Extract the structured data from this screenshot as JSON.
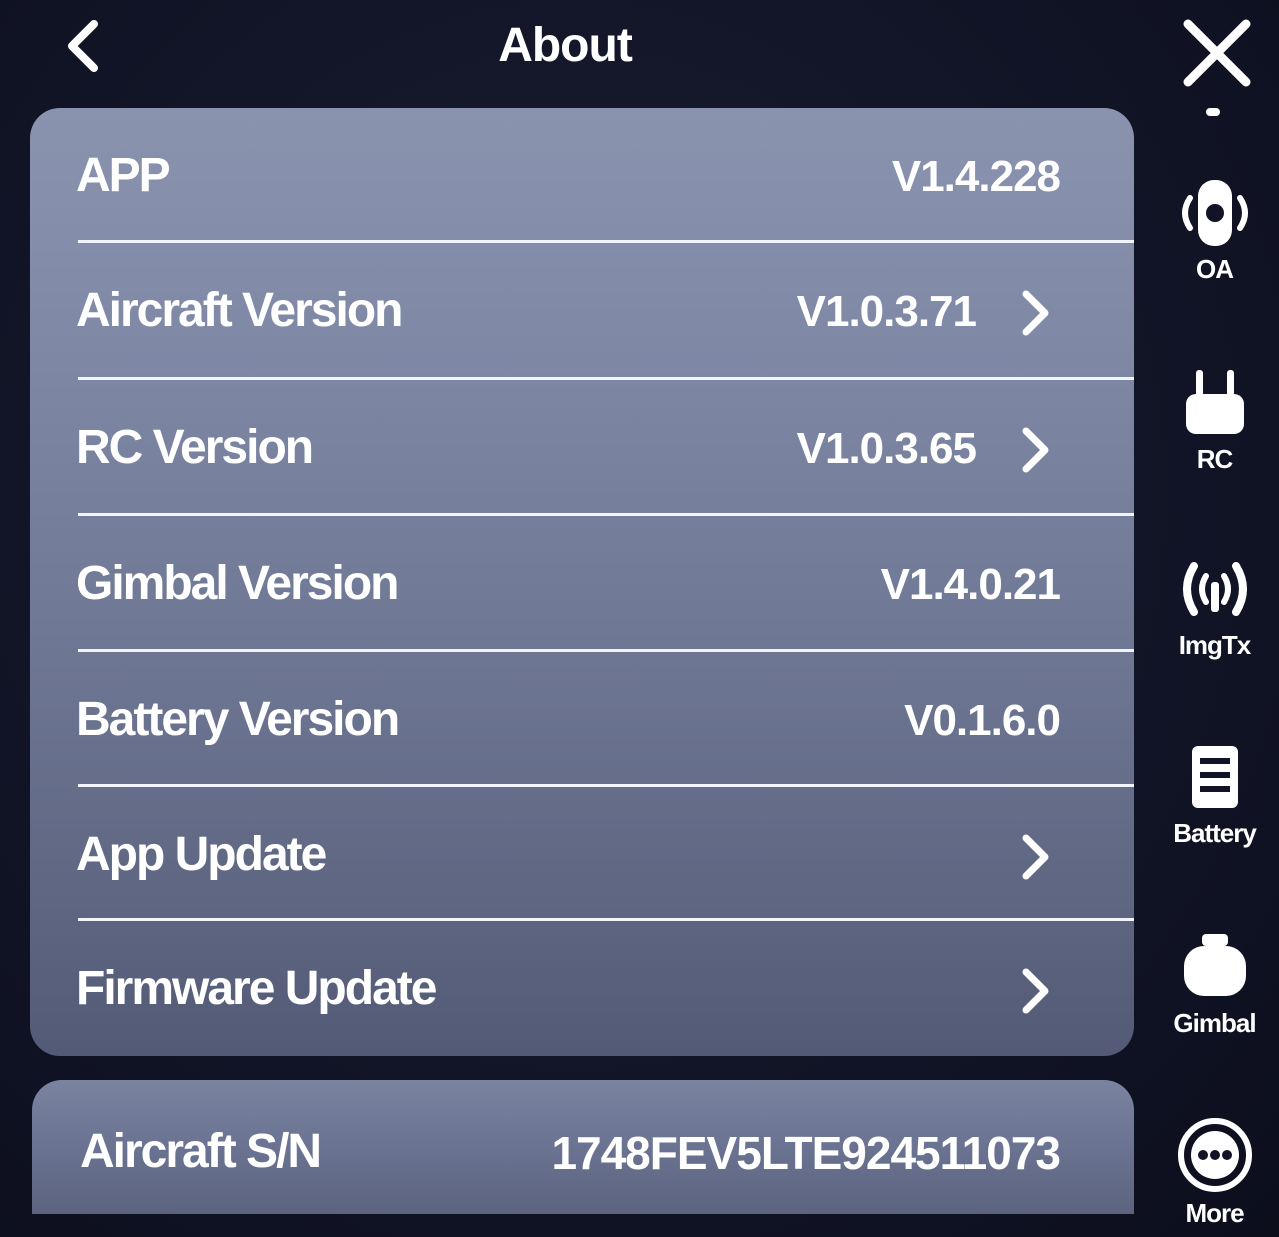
{
  "header": {
    "title": "About",
    "back_icon": "chevron-left-icon"
  },
  "about_list": {
    "rows": [
      {
        "label": "APP",
        "value": "V1.4.228",
        "has_chevron": false
      },
      {
        "label": "Aircraft Version",
        "value": "V1.0.3.71",
        "has_chevron": true
      },
      {
        "label": "RC Version",
        "value": "V1.0.3.65",
        "has_chevron": true
      },
      {
        "label": "Gimbal Version",
        "value": "V1.4.0.21",
        "has_chevron": false
      },
      {
        "label": "Battery Version",
        "value": "V0.1.6.0",
        "has_chevron": false
      },
      {
        "label": "App Update",
        "value": "",
        "has_chevron": true
      },
      {
        "label": "Firmware Update",
        "value": "",
        "has_chevron": true
      }
    ]
  },
  "serial": {
    "label": "Aircraft S/N",
    "value": "1748FEV5LTE924511073"
  },
  "sidebar": {
    "close_icon": "close-icon",
    "items": [
      {
        "label": "OA",
        "icon": "oa-drone-icon"
      },
      {
        "label": "RC",
        "icon": "remote-controller-icon"
      },
      {
        "label": "ImgTx",
        "icon": "transmission-icon"
      },
      {
        "label": "Battery",
        "icon": "battery-icon"
      },
      {
        "label": "Gimbal",
        "icon": "gimbal-camera-icon"
      },
      {
        "label": "More",
        "icon": "more-icon"
      }
    ]
  },
  "colors": {
    "background": "#111426",
    "panel": "#7f89a6",
    "divider": "#f2f4fb",
    "text": "#ffffff"
  }
}
